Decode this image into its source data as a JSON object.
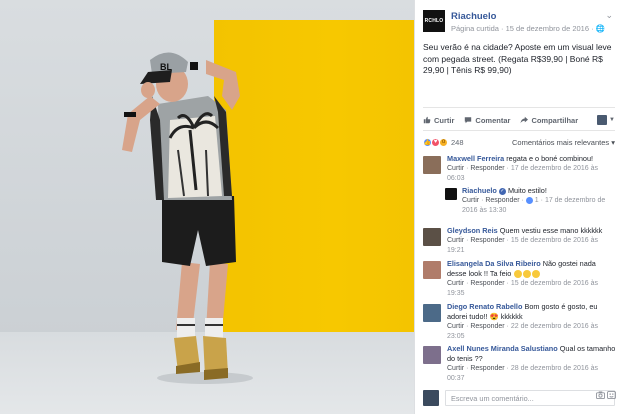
{
  "post": {
    "page_logo_text": "RCHLO",
    "page_name": "Riachuelo",
    "meta": "Página curtida · 15 de dezembro de 2016 · 🌐",
    "caption": "Seu verão é na cidade? Aposte em um visual leve com pegada street. (Regata R$39,90 | Boné R$ 29,90 | Tênis R$ 99,90)"
  },
  "actions": {
    "like": "Curtir",
    "comment": "Comentar",
    "share": "Compartilhar"
  },
  "reactions": {
    "count": "248",
    "sort": "Comentários mais relevantes ▾"
  },
  "comments": [
    {
      "author": "Maxwell Ferreira",
      "text": "regata e o boné combinou!",
      "like": "Curtir",
      "reply": "Responder",
      "time": "17 de dezembro de 2016 às 06:03"
    },
    {
      "author": "Riachuelo",
      "text": "Muito estilo!",
      "like": "Curtir",
      "reply": "Responder",
      "likes": "1",
      "time": "17 de dezembro de 2016 às 13:30"
    },
    {
      "author": "Gleydson Reis",
      "text": "Quem vestiu esse mano kkkkkk",
      "like": "Curtir",
      "reply": "Responder",
      "time": "15 de dezembro de 2016 às 19:21"
    },
    {
      "author": "Elisangela Da Silva Ribeiro",
      "text": "Não gostei nada desse look !! Ta feio",
      "like": "Curtir",
      "reply": "Responder",
      "time": "15 de dezembro de 2016 às 19:35"
    },
    {
      "author": "Diego Renato Rabello",
      "text": "Bom gosto é gosto, eu adorei tudo!! 😍 kkkkkk",
      "like": "Curtir",
      "reply": "Responder",
      "time": "22 de dezembro de 2016 às 23:05"
    },
    {
      "author": "Axell Nunes Miranda Salustiano",
      "text": "Qual os tamanho do tenis ??",
      "like": "Curtir",
      "reply": "Responder",
      "time": "28 de dezembro de 2016 às 00:37"
    }
  ],
  "composer": {
    "placeholder": "Escreva um comentário..."
  },
  "colors": {
    "link": "#365899",
    "wall": "#f5c500",
    "accent": "#4267b2"
  }
}
